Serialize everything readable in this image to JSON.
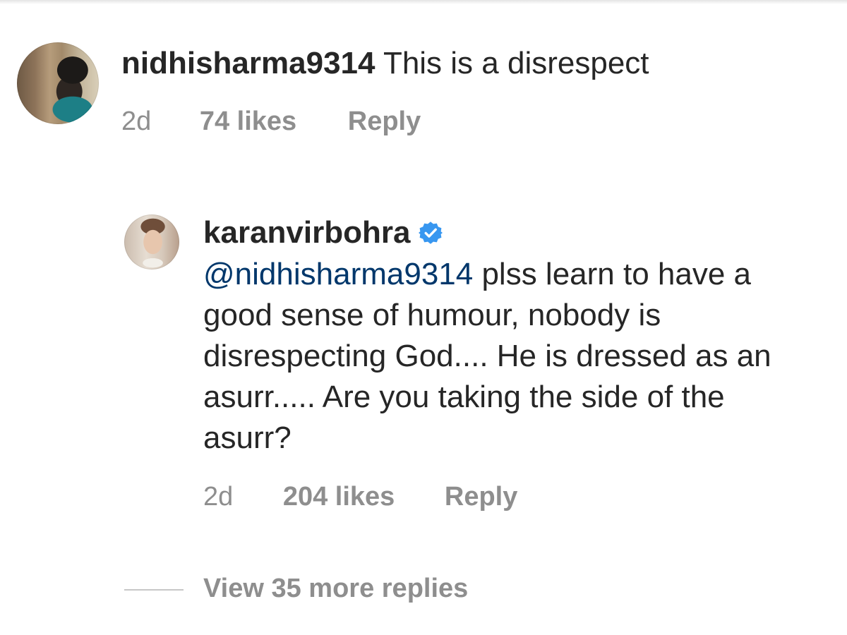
{
  "parent_comment": {
    "username": "nidhisharma9314",
    "text": "This is a disrespect",
    "time": "2d",
    "likes": "74 likes",
    "reply_label": "Reply"
  },
  "reply_comment": {
    "username": "karanvirbohra",
    "verified": true,
    "mention": "@nidhisharma9314",
    "text": " plss learn to have a good sense of humour, nobody is disrespecting God.... He is dressed as an asurr..... Are you taking the side of the asurr?",
    "time": "2d",
    "likes": "204 likes",
    "reply_label": "Reply"
  },
  "view_more_replies": "View 35 more replies",
  "colors": {
    "text": "#262626",
    "secondary": "#8e8e8e",
    "mention": "#00376b",
    "verified": "#3897f0"
  }
}
